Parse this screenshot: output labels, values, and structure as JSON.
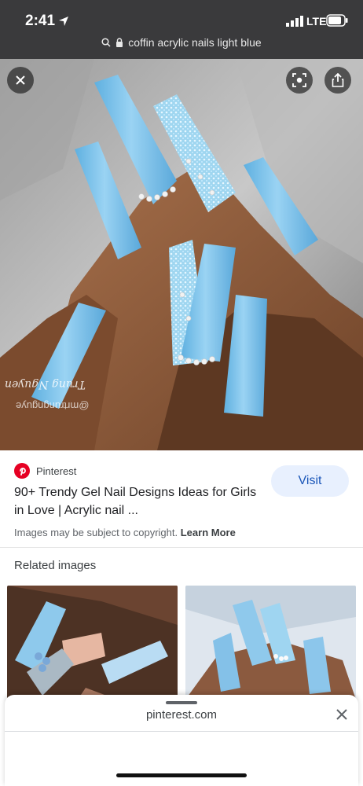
{
  "status_bar": {
    "time": "2:41",
    "network": "LTE"
  },
  "url_bar": {
    "query": "coffin acrylic nails light blue"
  },
  "hero": {
    "watermark_name": "Trung Nguyen",
    "watermark_handle": "@mrtrungnguye"
  },
  "result": {
    "source": "Pinterest",
    "title": "90+ Trendy Gel Nail Designs Ideas for Girls in Love | Acrylic nail ...",
    "visit_label": "Visit",
    "copyright_text": "Images may be subject to copyright.",
    "learn_more": "Learn More"
  },
  "related": {
    "heading": "Related images"
  },
  "sheet": {
    "domain": "pinterest.com"
  },
  "colors": {
    "nail_blue": "#7ec3ea",
    "visit_bg": "#e8f0fe",
    "visit_text": "#1a56b8",
    "pinterest_red": "#e60023"
  }
}
